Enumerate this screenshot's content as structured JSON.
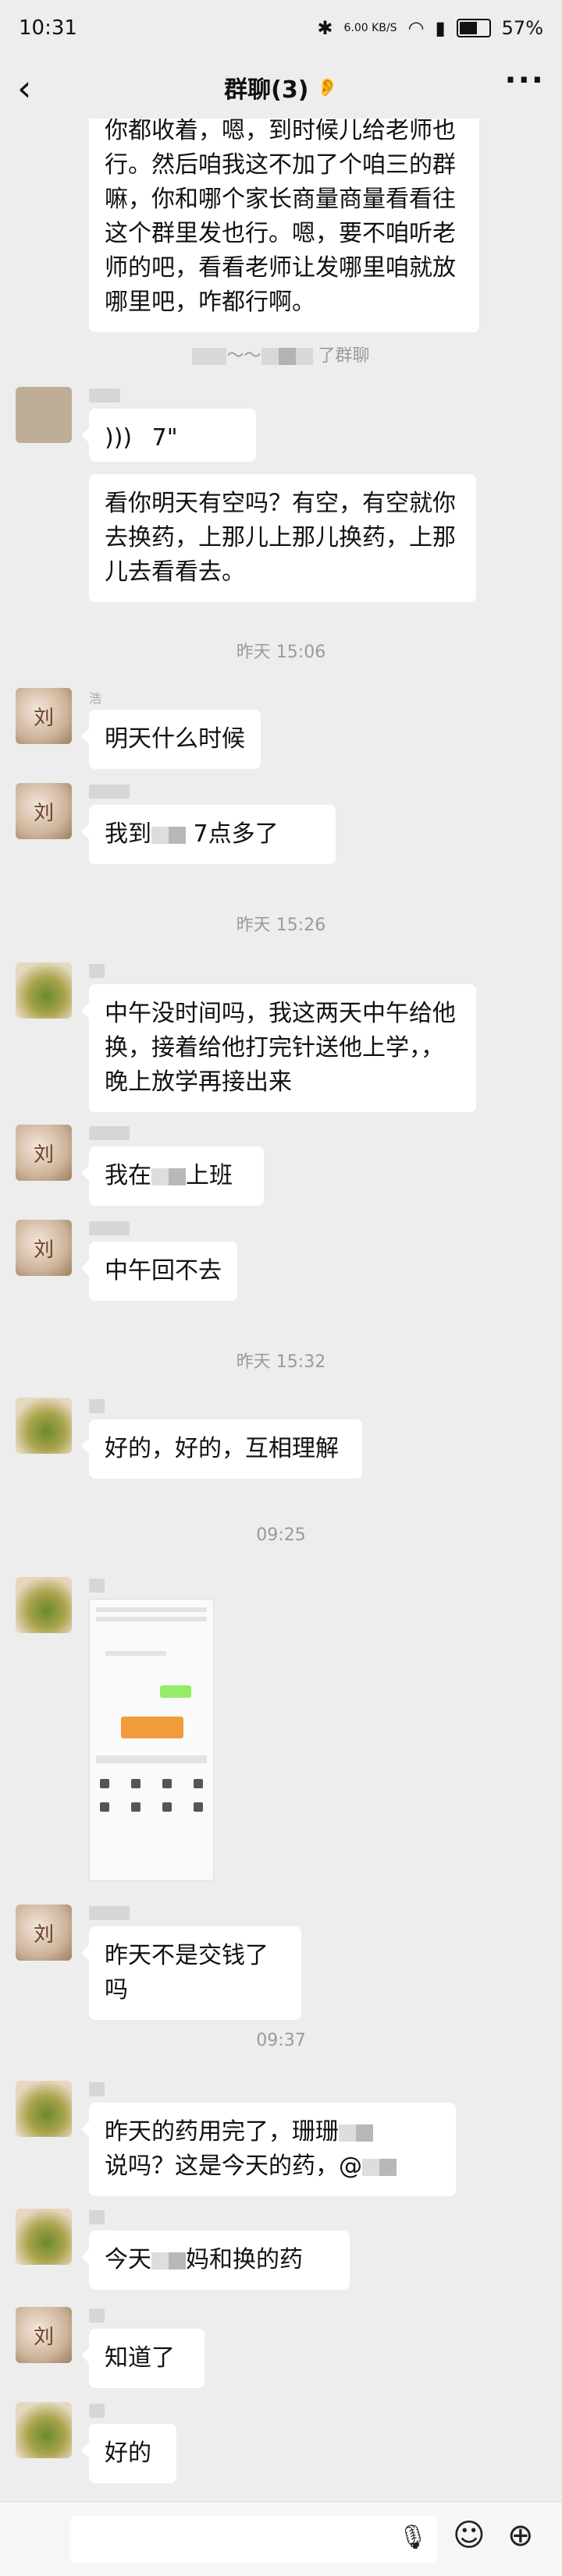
{
  "status_bar": {
    "time": "10:31",
    "speed": "6.00 KB/S",
    "battery": "57%"
  },
  "nav": {
    "back": "‹",
    "title": "群聊(3)",
    "mute_icon": "ear-icon",
    "more": "···"
  },
  "top_partial": {
    "text": "你都收着，嗯，到时候儿给老师也行。然后咱我这不加了个咱三的群嘛，你和哪个家长商量商量看看往这个群里发也行。嗯，要不咱听老师的吧，看看老师让发哪里咱就放哪里吧，咋都行啊。"
  },
  "system_join": {
    "text": "了群聊"
  },
  "messages": {
    "voice": {
      "duration": "7\""
    },
    "m1": "看你明天有空吗？有空，有空就你去换药，上那儿上那儿换药，上那儿去看看去。",
    "ts1": "昨天 15:06",
    "m2_sender": "浩",
    "m2": "明天什么时候",
    "m3a": "我到",
    "m3b": "7点多了",
    "ts2": "昨天 15:26",
    "m4": "中午没时间吗，我这两天中午给他换，接着给他打完针送他上学，，晚上放学再接出来",
    "m5a": "我在",
    "m5b": "上班",
    "m6": "中午回不去",
    "ts3": "昨天 15:32",
    "m7": "好的，好的，互相理解",
    "ts4": "09:25",
    "m8": "昨天不是交钱了吗",
    "ts5": "09:37",
    "m9a": "昨天的药用完了，珊珊",
    "m9b": "说吗？这是今天的药，@",
    "m10a": "今天",
    "m10b": "妈和换的药",
    "m11": "知道了",
    "m12": "好的"
  },
  "avatar_char": "刘",
  "input_bar": {
    "voice_icon": "microphone-icon",
    "emoji_icon": "emoji-icon",
    "plus_icon": "plus-icon"
  }
}
